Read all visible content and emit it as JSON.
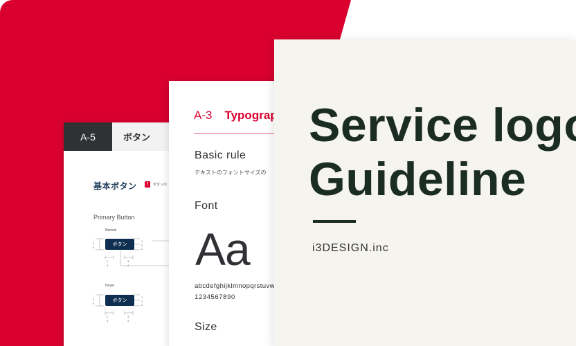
{
  "colors": {
    "brand_red": "#d9002f",
    "dark_header": "#2f3134",
    "cover_background": "#f5f4ef",
    "title_green": "#1b2c22",
    "button_navy": "#0e2f4f"
  },
  "card_buttons": {
    "code": "A-5",
    "title": "ボタン",
    "section": "基本ボタン",
    "warning_icon": "exclamation-icon",
    "note": "ボタンの",
    "primary_label": "Primary Button",
    "normal_label": "Normal",
    "hover_label": "Hover",
    "button_label": "ボタン",
    "dims_left": "4\n6",
    "dims_right": "1\n2\n2",
    "dims_bottom_a": "2\n4",
    "dims_bottom_b": "3\n4"
  },
  "card_typography": {
    "code": "A-3",
    "title": "Typography",
    "basic_rule": "Basic rule",
    "basic_rule_desc": "テキストのフォントサイズの",
    "font": "Font",
    "sample": "Aa",
    "letters": "abcdefghijklmnopqrstuvw",
    "digits": "1234567890",
    "size": "Size"
  },
  "cover": {
    "title_line1": "Service logo",
    "title_line2": "Guideline",
    "company": "i3DESIGN.inc"
  }
}
